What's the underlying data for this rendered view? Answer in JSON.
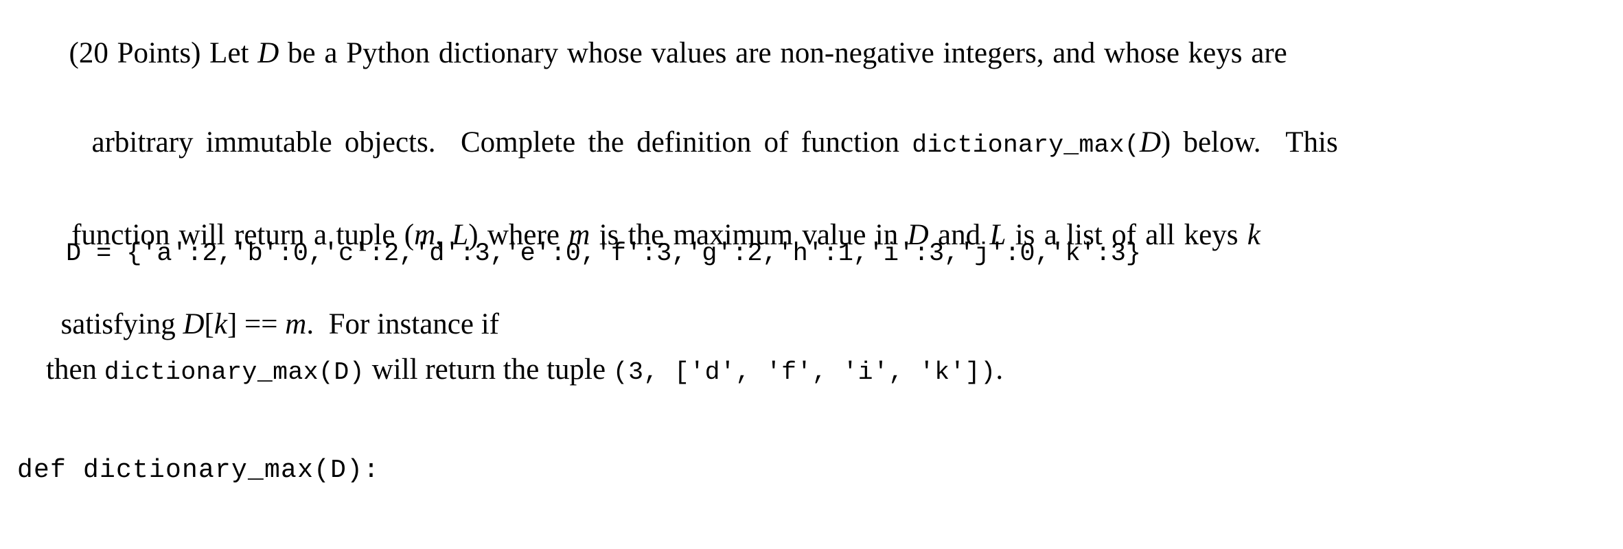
{
  "document": {
    "problem": {
      "points_label": "(20 Points)",
      "paragraph_lines": [
        {
          "id": "line1",
          "text": "(20 Points) Let D be a Python dictionary whose values are non-negative integers, and whose keys are",
          "segments": [
            {
              "kind": "roman",
              "text": "(20 Points) Let "
            },
            {
              "kind": "italic",
              "text": "D"
            },
            {
              "kind": "roman",
              "text": " be a Python dictionary whose values are non-negative integers, and whose keys are"
            }
          ]
        },
        {
          "id": "line2",
          "text": "arbitrary immutable objects. Complete the definition of function dictionary_max(D) below. This",
          "segments": [
            {
              "kind": "roman",
              "text": "arbitrary immutable objects.  Complete the definition of function "
            },
            {
              "kind": "roman",
              "text": "dictionary_max("
            },
            {
              "kind": "italic",
              "text": "D"
            },
            {
              "kind": "roman",
              "text": ") below.  This"
            }
          ]
        },
        {
          "id": "line3",
          "text": "function will return a tuple (m, L) where m is the maximum value in D and L is a list of all keys k",
          "segments": [
            {
              "kind": "roman",
              "text": "function will return a tuple ("
            },
            {
              "kind": "italic",
              "text": "m"
            },
            {
              "kind": "roman",
              "text": ", "
            },
            {
              "kind": "italic",
              "text": "L"
            },
            {
              "kind": "roman",
              "text": ") where "
            },
            {
              "kind": "italic",
              "text": "m"
            },
            {
              "kind": "roman",
              "text": " is the maximum value in "
            },
            {
              "kind": "italic",
              "text": "D"
            },
            {
              "kind": "roman",
              "text": " and "
            },
            {
              "kind": "italic",
              "text": "L"
            },
            {
              "kind": "roman",
              "text": " is a list of all keys "
            },
            {
              "kind": "italic",
              "text": "k"
            }
          ]
        },
        {
          "id": "line4",
          "text": "satisfying D[k] == m. For instance if",
          "segments": [
            {
              "kind": "roman",
              "text": "satisfying "
            },
            {
              "kind": "italic",
              "text": "D"
            },
            {
              "kind": "roman",
              "text": "["
            },
            {
              "kind": "italic",
              "text": "k"
            },
            {
              "kind": "roman",
              "text": "] == "
            },
            {
              "kind": "italic",
              "text": "m"
            },
            {
              "kind": "roman",
              "text": ".  For instance if"
            }
          ]
        }
      ]
    },
    "dict_example": {
      "code": "D = {'a':2,'b':0,'c':2,'d':3,'e':0,'f':3,'g':2,'h':1,'i':3,'j':0,'k':3}",
      "variable": "D",
      "entries": [
        {
          "key": "'a'",
          "value": "2"
        },
        {
          "key": "'b'",
          "value": "0"
        },
        {
          "key": "'c'",
          "value": "2"
        },
        {
          "key": "'d'",
          "value": "3"
        },
        {
          "key": "'e'",
          "value": "0"
        },
        {
          "key": "'f'",
          "value": "3"
        },
        {
          "key": "'g'",
          "value": "2"
        },
        {
          "key": "'h'",
          "value": "1"
        },
        {
          "key": "'i'",
          "value": "3"
        },
        {
          "key": "'j'",
          "value": "0"
        },
        {
          "key": "'k'",
          "value": "3"
        }
      ]
    },
    "result_sentence": {
      "lead_word": "then",
      "call_code": "dictionary_max(D)",
      "middle_text": " will return the tuple ",
      "tuple_code": "(3, ['d', 'f', 'i', 'k'])",
      "trailing_text": ".",
      "max_value": "3",
      "max_keys": [
        "'d'",
        "'f'",
        "'i'",
        "'k'"
      ]
    },
    "answer_stub": {
      "code": "def dictionary_max(D):",
      "keyword": "def",
      "function_name": "dictionary_max",
      "parameter": "D"
    },
    "colors": {
      "background": "#ffffff",
      "text": "#000000"
    }
  }
}
